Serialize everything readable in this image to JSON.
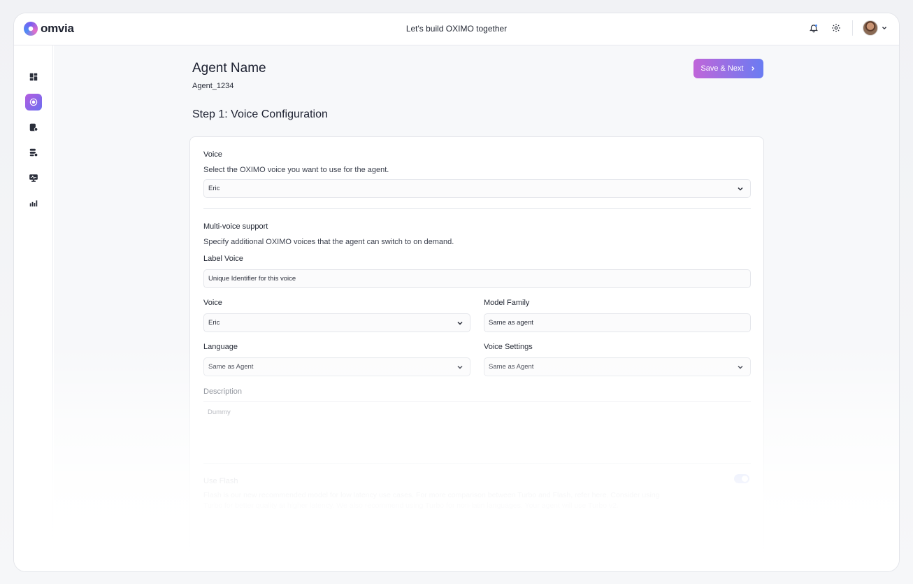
{
  "app": {
    "logo_text": "omvia",
    "title": "Let's build OXIMO together"
  },
  "header": {
    "agent_title": "Agent Name",
    "agent_id": "Agent_1234",
    "save_label": "Save & Next",
    "step_title": "Step 1: Voice Configuration"
  },
  "voice": {
    "label": "Voice",
    "description": "Select the OXIMO voice you want to use for the agent.",
    "selected": "Eric"
  },
  "multi_voice": {
    "label": "Multi-voice support",
    "description": "Specify additional OXIMO voices that the agent can switch to on demand.",
    "label_voice": "Label Voice",
    "label_voice_value": "Unique Identifier for this voice",
    "voice_label": "Voice",
    "voice_value": "Eric",
    "model_family_label": "Model Family",
    "model_family_value": "Same as agent",
    "language_label": "Language",
    "language_value": "Same as Agent",
    "voice_settings_label": "Voice Settings",
    "voice_settings_value": "Same as Agent",
    "description_label": "Description",
    "description_value": "Dummy"
  },
  "flash": {
    "label": "Use Flash",
    "description": "Flash is our new recommended model for low latency use cases. For more comparison between Turbo and Flash, refer here. Consider using Turbo for better quality at higher latency. We also recommend using Turbo for non-latin languages. Your agent will use Turbo v2.",
    "enabled": true
  },
  "colors": {
    "accent_start": "#c065d9",
    "accent_end": "#6a7cf2"
  }
}
